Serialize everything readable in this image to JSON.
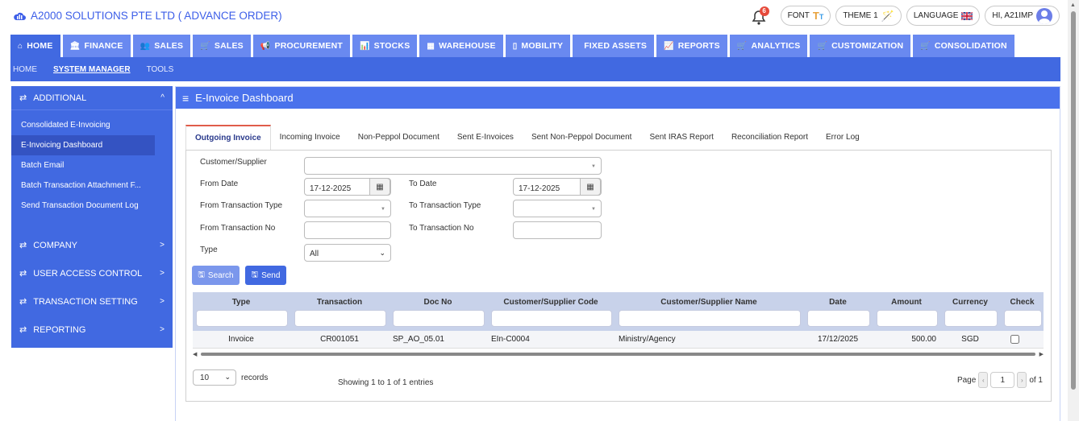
{
  "header": {
    "title": "A2000 SOLUTIONS PTE LTD ( ADVANCE ORDER)",
    "notification_count": "6",
    "font_label": "FONT",
    "theme_label": "THEME 1",
    "language_label": "LANGUAGE",
    "user_label": "HI, A21IMP"
  },
  "nav": {
    "tabs": [
      {
        "label": "HOME",
        "icon": "⌂"
      },
      {
        "label": "FINANCE",
        "icon": "🏛"
      },
      {
        "label": "SALES",
        "icon": "👥"
      },
      {
        "label": "SALES",
        "icon": "🛒"
      },
      {
        "label": "PROCUREMENT",
        "icon": "📢"
      },
      {
        "label": "STOCKS",
        "icon": "📊"
      },
      {
        "label": "WAREHOUSE",
        "icon": "▦"
      },
      {
        "label": "MOBILITY",
        "icon": "▯"
      },
      {
        "label": "FIXED ASSETS",
        "icon": ""
      },
      {
        "label": "REPORTS",
        "icon": "📈"
      },
      {
        "label": "ANALYTICS",
        "icon": "🛒"
      },
      {
        "label": "CUSTOMIZATION",
        "icon": "🛒"
      },
      {
        "label": "CONSOLIDATION",
        "icon": "🛒"
      }
    ],
    "subnav": [
      "HOME",
      "SYSTEM MANAGER",
      "TOOLS"
    ]
  },
  "sidebar": {
    "header": "ADDITIONAL",
    "items": [
      "Consolidated E-Invoicing",
      "E-Invoicing Dashboard",
      "Batch Email",
      "Batch Transaction Attachment F...",
      "Send Transaction Document Log"
    ],
    "sections": [
      "COMPANY",
      "USER ACCESS CONTROL",
      "TRANSACTION SETTING",
      "REPORTING"
    ]
  },
  "main": {
    "title": "E-Invoice Dashboard",
    "tabs": [
      "Outgoing Invoice",
      "Incoming Invoice",
      "Non-Peppol Document",
      "Sent E-Invoices",
      "Sent Non-Peppol Document",
      "Sent IRAS Report",
      "Reconciliation Report",
      "Error Log"
    ]
  },
  "form": {
    "customer_label": "Customer/Supplier",
    "from_date_label": "From Date",
    "from_date_value": "17-12-2025",
    "to_date_label": "To Date",
    "to_date_value": "17-12-2025",
    "from_type_label": "From Transaction Type",
    "to_type_label": "To Transaction Type",
    "from_no_label": "From Transaction No",
    "to_no_label": "To Transaction No",
    "type_label": "Type",
    "type_value": "All",
    "search_label": "Search",
    "send_label": "Send"
  },
  "table": {
    "columns": [
      "Type",
      "Transaction",
      "Doc No",
      "Customer/Supplier Code",
      "Customer/Supplier Name",
      "Date",
      "Amount",
      "Currency",
      "Check"
    ],
    "rows": [
      [
        "Invoice",
        "CR001051",
        "SP_AO_05.01",
        "EIn-C0004",
        "Ministry/Agency",
        "17/12/2025",
        "500.00",
        "SGD"
      ]
    ]
  },
  "footer": {
    "records_value": "10",
    "records_label": "records",
    "showing": "Showing 1 to 1 of 1 entries",
    "page_label": "Page",
    "page_value": "1",
    "of_label": "of 1"
  }
}
